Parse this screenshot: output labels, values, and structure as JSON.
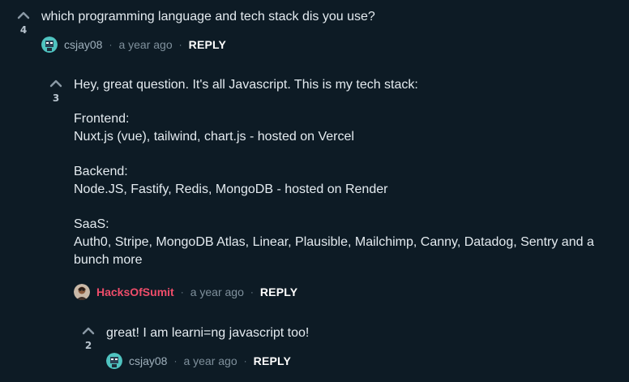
{
  "comments": [
    {
      "votes": "4",
      "text": "which programming language and tech stack dis you use?",
      "author": "csjay08",
      "time": "a year ago",
      "reply_label": "REPLY"
    },
    {
      "votes": "3",
      "paragraphs": [
        [
          "Hey, great question. It's all Javascript. This is my tech stack:"
        ],
        [
          "Frontend:",
          "Nuxt.js (vue), tailwind, chart.js - hosted on Vercel"
        ],
        [
          "Backend:",
          "Node.JS, Fastify, Redis, MongoDB - hosted on Render"
        ],
        [
          "SaaS:",
          "Auth0, Stripe, MongoDB Atlas, Linear, Plausible, Mailchimp, Canny, Datadog, Sentry and a",
          "bunch more"
        ]
      ],
      "author": "HacksOfSumit",
      "time": "a year ago",
      "reply_label": "REPLY"
    },
    {
      "votes": "2",
      "text": "great! I am learni=ng javascript too!",
      "author": "csjay08",
      "time": "a year ago",
      "reply_label": "REPLY"
    }
  ],
  "separator": "·",
  "colors": {
    "background": "#0d1b25",
    "op_author": "#ef4d6a",
    "text": "#e4ebf0",
    "meta": "#7f909c"
  },
  "icons": {
    "upvote": "chevron-up-icon",
    "avatar_csjay08": "avatar-teal-icon",
    "avatar_hacksofsumit": "avatar-photo-icon"
  }
}
